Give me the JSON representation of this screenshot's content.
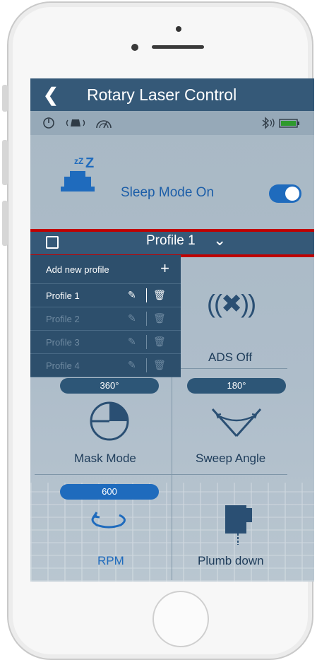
{
  "header": {
    "back_icon": "chevron-left-icon",
    "title": "Rotary Laser Control"
  },
  "status_bar": {
    "icons": [
      "power-icon",
      "laser-pointer-icon",
      "gauge-icon",
      "bluetooth-icon",
      "battery-icon"
    ]
  },
  "sleep": {
    "label": "Sleep Mode On",
    "toggle_on": true
  },
  "profile": {
    "selected": "Profile 1"
  },
  "dropdown": {
    "add_label": "Add new profile",
    "items": [
      {
        "label": "Profile 1",
        "enabled": true
      },
      {
        "label": "Profile 2",
        "enabled": false
      },
      {
        "label": "Profile 3",
        "enabled": false
      },
      {
        "label": "Profile 4",
        "enabled": false
      }
    ]
  },
  "tiles": {
    "ads": {
      "label": "ADS Off"
    },
    "mask": {
      "value": "360°",
      "label": "Mask Mode"
    },
    "sweep": {
      "value": "180°",
      "label": "Sweep Angle"
    },
    "rpm": {
      "value": "600",
      "label": "RPM"
    },
    "plumb": {
      "label": "Plumb down"
    }
  },
  "colors": {
    "header": "#355978",
    "accent": "#1f6bbd",
    "highlight": "#c00000"
  }
}
